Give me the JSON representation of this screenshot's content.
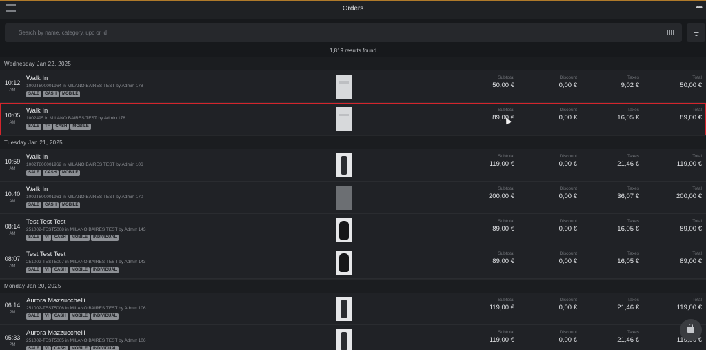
{
  "header": {
    "title": "Orders",
    "more_label": "•••"
  },
  "search": {
    "placeholder": "Search by name, category, upc or id"
  },
  "results_text": "1,819 results found",
  "labels": {
    "subtotal": "Subtotal",
    "discount": "Discount",
    "taxes": "Taxes",
    "total": "Total"
  },
  "groups": [
    {
      "date": "Wednesday Jan 22, 2025",
      "orders": [
        {
          "time": "10:12",
          "ampm": "AM",
          "name": "Walk In",
          "sub": "1002T800001964 in MILANO BAIRES TEST by Admin 178",
          "tags": [
            "SALE",
            "CASH",
            "MOBILE"
          ],
          "thumb": "white-shirt",
          "subtotal": "50,00 €",
          "discount": "0,00 €",
          "taxes": "9,02 €",
          "total": "50,00 €"
        },
        {
          "time": "10:05",
          "ampm": "AM",
          "name": "Walk In",
          "sub": "1002495 in MILANO BAIRES TEST by Admin 178",
          "tags": [
            "SALE",
            "TF",
            "CASH",
            "MOBILE"
          ],
          "thumb": "white-shirt",
          "subtotal": "89,00 €",
          "discount": "0,00 €",
          "taxes": "16,05 €",
          "total": "89,00 €",
          "selected": true
        }
      ]
    },
    {
      "date": "Tuesday Jan 21, 2025",
      "orders": [
        {
          "time": "10:59",
          "ampm": "AM",
          "name": "Walk In",
          "sub": "1002T800001962 in MILANO BAIRES TEST by Admin 106",
          "tags": [
            "SALE",
            "CASH",
            "MOBILE"
          ],
          "thumb": "person",
          "subtotal": "119,00 €",
          "discount": "0,00 €",
          "taxes": "21,46 €",
          "total": "119,00 €"
        },
        {
          "time": "10:40",
          "ampm": "AM",
          "name": "Walk In",
          "sub": "1002T800001961 in MILANO BAIRES TEST by Admin 170",
          "tags": [
            "SALE",
            "CASH",
            "MOBILE"
          ],
          "thumb": "grey-item",
          "subtotal": "200,00 €",
          "discount": "0,00 €",
          "taxes": "36,07 €",
          "total": "200,00 €"
        },
        {
          "time": "08:14",
          "ampm": "AM",
          "name": "Test Test Test",
          "sub": "251002-TEST5008 in MILANO BAIRES TEST by Admin 143",
          "tags": [
            "SALE",
            "VI",
            "CASH",
            "MOBILE",
            "INDIVIDUAL"
          ],
          "thumb": "glove",
          "subtotal": "89,00 €",
          "discount": "0,00 €",
          "taxes": "16,05 €",
          "total": "89,00 €"
        },
        {
          "time": "08:07",
          "ampm": "AM",
          "name": "Test Test Test",
          "sub": "251002-TEST5007 in MILANO BAIRES TEST by Admin 143",
          "tags": [
            "SALE",
            "VI",
            "CASH",
            "MOBILE",
            "INDIVIDUAL"
          ],
          "thumb": "glove",
          "subtotal": "89,00 €",
          "discount": "0,00 €",
          "taxes": "16,05 €",
          "total": "89,00 €"
        }
      ]
    },
    {
      "date": "Monday Jan 20, 2025",
      "orders": [
        {
          "time": "06:14",
          "ampm": "PM",
          "name": "Aurora Mazzucchelli",
          "sub": "251002-TEST5006 in MILANO BAIRES TEST by Admin 106",
          "tags": [
            "SALE",
            "VI",
            "CASH",
            "MOBILE",
            "INDIVIDUAL"
          ],
          "thumb": "person",
          "subtotal": "119,00 €",
          "discount": "0,00 €",
          "taxes": "21,46 €",
          "total": "119,00 €"
        },
        {
          "time": "05:33",
          "ampm": "PM",
          "name": "Aurora Mazzucchelli",
          "sub": "251002-TEST5005 in MILANO BAIRES TEST by Admin 106",
          "tags": [
            "SALE",
            "VI",
            "CASH",
            "MOBILE",
            "INDIVIDUAL"
          ],
          "thumb": "person",
          "subtotal": "119,00 €",
          "discount": "0,00 €",
          "taxes": "21,46 €",
          "total": "119,00 €"
        }
      ]
    }
  ]
}
